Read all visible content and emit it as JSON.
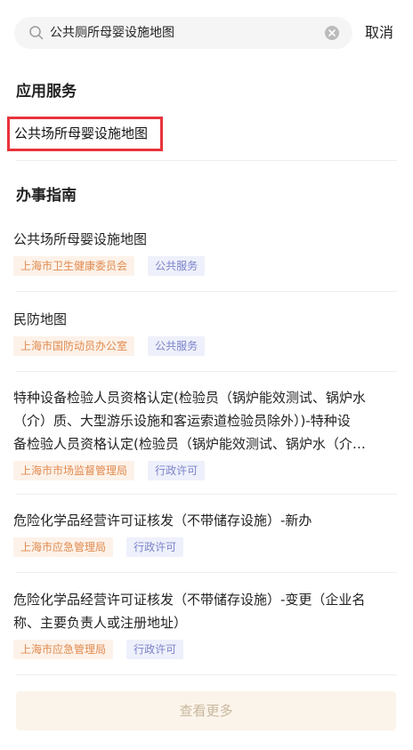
{
  "search": {
    "query": "公共厕所母婴设施地图",
    "cancel_label": "取消"
  },
  "app_services": {
    "title": "应用服务",
    "items": [
      {
        "label": "公共场所母婴设施地图"
      }
    ]
  },
  "guides": {
    "title": "办事指南",
    "items": [
      {
        "title": "公共场所母婴设施地图",
        "org": "上海市卫生健康委员会",
        "category": "公共服务"
      },
      {
        "title": "民防地图",
        "org": "上海市国防动员办公室",
        "category": "公共服务"
      },
      {
        "title_lines": [
          "特种设备检验人员资格认定(检验员（锅炉能效测试、锅炉水",
          "（介）质、大型游乐设施和客运索道检验员除外）)-特种设",
          "备检验人员资格认定(检验员（锅炉能效测试、锅炉水（介…"
        ],
        "org": "上海市市场监督管理局",
        "category": "行政许可"
      },
      {
        "title": "危险化学品经营许可证核发（不带储存设施）-新办",
        "org": "上海市应急管理局",
        "category": "行政许可"
      },
      {
        "title_lines": [
          "危险化学品经营许可证核发（不带储存设施）-变更（企业名",
          "称、主要负责人或注册地址）"
        ],
        "org": "上海市应急管理局",
        "category": "行政许可"
      }
    ]
  },
  "more_label": "查看更多",
  "colors": {
    "highlight_border": "#e8333a",
    "org_tag_bg": "#fdf2e9",
    "org_tag_text": "#e08a4e",
    "category_tag_bg": "#eef0fb",
    "category_tag_text": "#7b83c9"
  },
  "icons": [
    "search-icon",
    "clear-icon"
  ]
}
